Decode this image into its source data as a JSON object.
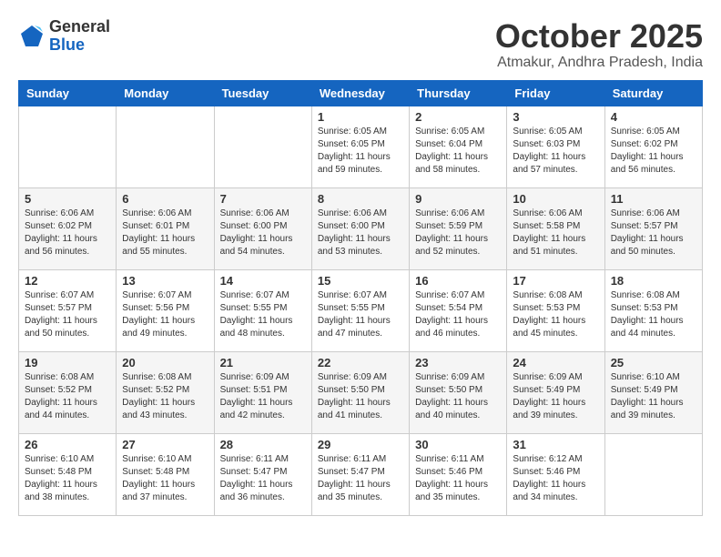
{
  "logo": {
    "general": "General",
    "blue": "Blue"
  },
  "header": {
    "month": "October 2025",
    "location": "Atmakur, Andhra Pradesh, India"
  },
  "weekdays": [
    "Sunday",
    "Monday",
    "Tuesday",
    "Wednesday",
    "Thursday",
    "Friday",
    "Saturday"
  ],
  "weeks": [
    [
      {
        "day": "",
        "info": ""
      },
      {
        "day": "",
        "info": ""
      },
      {
        "day": "",
        "info": ""
      },
      {
        "day": "1",
        "info": "Sunrise: 6:05 AM\nSunset: 6:05 PM\nDaylight: 11 hours\nand 59 minutes."
      },
      {
        "day": "2",
        "info": "Sunrise: 6:05 AM\nSunset: 6:04 PM\nDaylight: 11 hours\nand 58 minutes."
      },
      {
        "day": "3",
        "info": "Sunrise: 6:05 AM\nSunset: 6:03 PM\nDaylight: 11 hours\nand 57 minutes."
      },
      {
        "day": "4",
        "info": "Sunrise: 6:05 AM\nSunset: 6:02 PM\nDaylight: 11 hours\nand 56 minutes."
      }
    ],
    [
      {
        "day": "5",
        "info": "Sunrise: 6:06 AM\nSunset: 6:02 PM\nDaylight: 11 hours\nand 56 minutes."
      },
      {
        "day": "6",
        "info": "Sunrise: 6:06 AM\nSunset: 6:01 PM\nDaylight: 11 hours\nand 55 minutes."
      },
      {
        "day": "7",
        "info": "Sunrise: 6:06 AM\nSunset: 6:00 PM\nDaylight: 11 hours\nand 54 minutes."
      },
      {
        "day": "8",
        "info": "Sunrise: 6:06 AM\nSunset: 6:00 PM\nDaylight: 11 hours\nand 53 minutes."
      },
      {
        "day": "9",
        "info": "Sunrise: 6:06 AM\nSunset: 5:59 PM\nDaylight: 11 hours\nand 52 minutes."
      },
      {
        "day": "10",
        "info": "Sunrise: 6:06 AM\nSunset: 5:58 PM\nDaylight: 11 hours\nand 51 minutes."
      },
      {
        "day": "11",
        "info": "Sunrise: 6:06 AM\nSunset: 5:57 PM\nDaylight: 11 hours\nand 50 minutes."
      }
    ],
    [
      {
        "day": "12",
        "info": "Sunrise: 6:07 AM\nSunset: 5:57 PM\nDaylight: 11 hours\nand 50 minutes."
      },
      {
        "day": "13",
        "info": "Sunrise: 6:07 AM\nSunset: 5:56 PM\nDaylight: 11 hours\nand 49 minutes."
      },
      {
        "day": "14",
        "info": "Sunrise: 6:07 AM\nSunset: 5:55 PM\nDaylight: 11 hours\nand 48 minutes."
      },
      {
        "day": "15",
        "info": "Sunrise: 6:07 AM\nSunset: 5:55 PM\nDaylight: 11 hours\nand 47 minutes."
      },
      {
        "day": "16",
        "info": "Sunrise: 6:07 AM\nSunset: 5:54 PM\nDaylight: 11 hours\nand 46 minutes."
      },
      {
        "day": "17",
        "info": "Sunrise: 6:08 AM\nSunset: 5:53 PM\nDaylight: 11 hours\nand 45 minutes."
      },
      {
        "day": "18",
        "info": "Sunrise: 6:08 AM\nSunset: 5:53 PM\nDaylight: 11 hours\nand 44 minutes."
      }
    ],
    [
      {
        "day": "19",
        "info": "Sunrise: 6:08 AM\nSunset: 5:52 PM\nDaylight: 11 hours\nand 44 minutes."
      },
      {
        "day": "20",
        "info": "Sunrise: 6:08 AM\nSunset: 5:52 PM\nDaylight: 11 hours\nand 43 minutes."
      },
      {
        "day": "21",
        "info": "Sunrise: 6:09 AM\nSunset: 5:51 PM\nDaylight: 11 hours\nand 42 minutes."
      },
      {
        "day": "22",
        "info": "Sunrise: 6:09 AM\nSunset: 5:50 PM\nDaylight: 11 hours\nand 41 minutes."
      },
      {
        "day": "23",
        "info": "Sunrise: 6:09 AM\nSunset: 5:50 PM\nDaylight: 11 hours\nand 40 minutes."
      },
      {
        "day": "24",
        "info": "Sunrise: 6:09 AM\nSunset: 5:49 PM\nDaylight: 11 hours\nand 39 minutes."
      },
      {
        "day": "25",
        "info": "Sunrise: 6:10 AM\nSunset: 5:49 PM\nDaylight: 11 hours\nand 39 minutes."
      }
    ],
    [
      {
        "day": "26",
        "info": "Sunrise: 6:10 AM\nSunset: 5:48 PM\nDaylight: 11 hours\nand 38 minutes."
      },
      {
        "day": "27",
        "info": "Sunrise: 6:10 AM\nSunset: 5:48 PM\nDaylight: 11 hours\nand 37 minutes."
      },
      {
        "day": "28",
        "info": "Sunrise: 6:11 AM\nSunset: 5:47 PM\nDaylight: 11 hours\nand 36 minutes."
      },
      {
        "day": "29",
        "info": "Sunrise: 6:11 AM\nSunset: 5:47 PM\nDaylight: 11 hours\nand 35 minutes."
      },
      {
        "day": "30",
        "info": "Sunrise: 6:11 AM\nSunset: 5:46 PM\nDaylight: 11 hours\nand 35 minutes."
      },
      {
        "day": "31",
        "info": "Sunrise: 6:12 AM\nSunset: 5:46 PM\nDaylight: 11 hours\nand 34 minutes."
      },
      {
        "day": "",
        "info": ""
      }
    ]
  ]
}
